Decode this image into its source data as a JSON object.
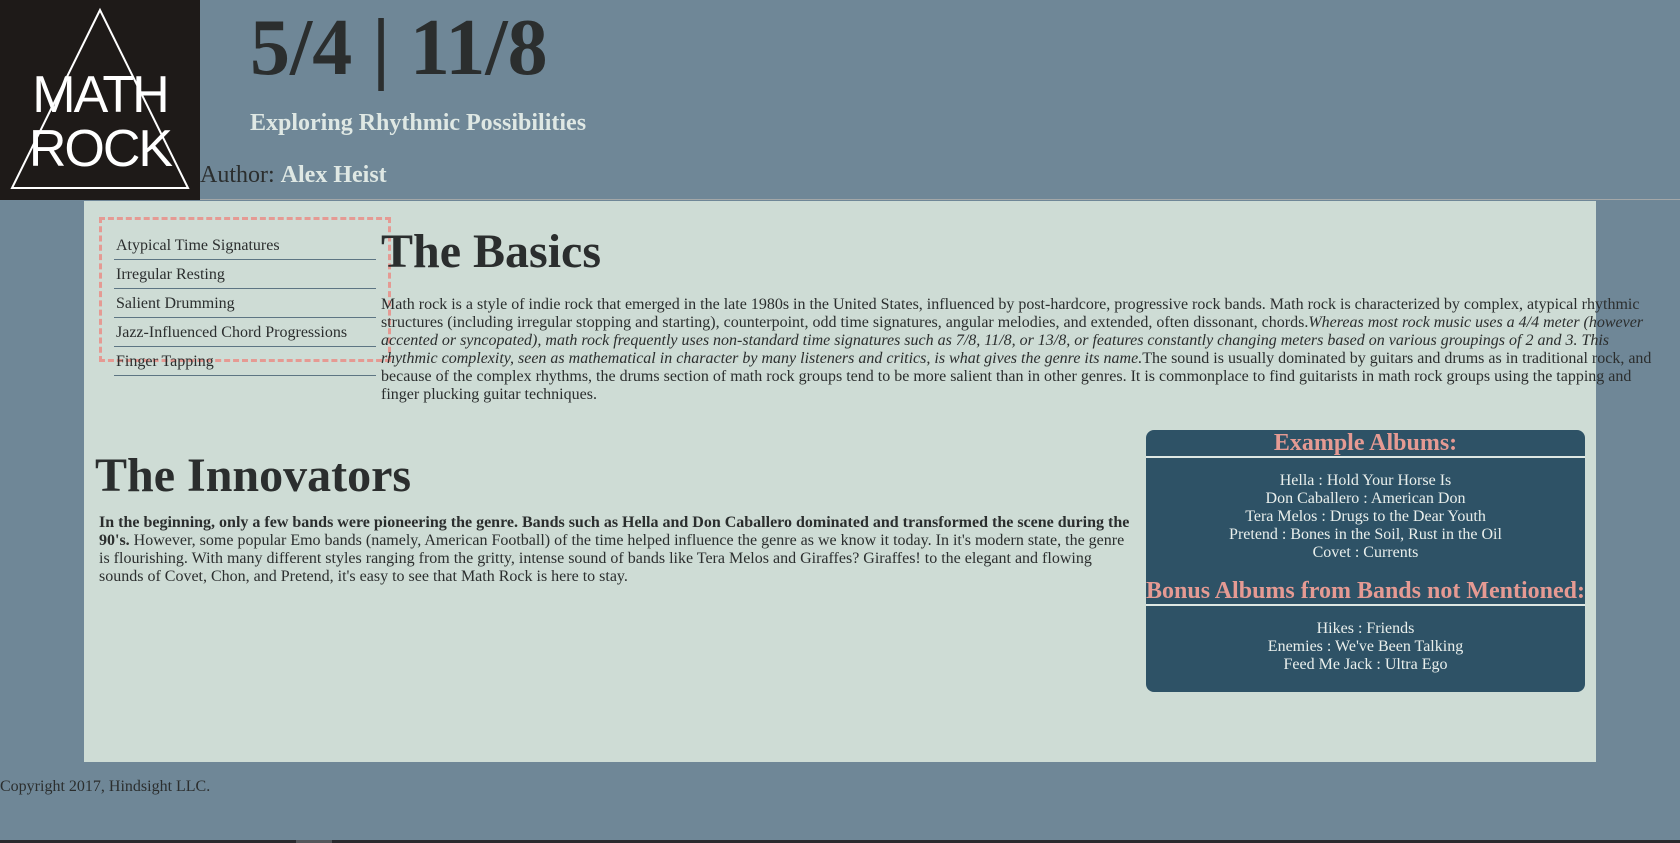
{
  "header": {
    "logo_text": "MATH ROCK",
    "title": "5/4 | 11/8",
    "subtitle": "Exploring Rhythmic Possibilities",
    "author_label": "Author:",
    "author_name": "Alex Heist"
  },
  "sidebar": {
    "items": [
      {
        "label": "Atypical Time Signatures"
      },
      {
        "label": "Irregular Resting"
      },
      {
        "label": "Salient Drumming"
      },
      {
        "label": "Jazz-Influenced Chord Progressions"
      },
      {
        "label": "Finger Tapping"
      }
    ]
  },
  "basics": {
    "title": "The Basics",
    "text_1": "Math rock is a style of indie rock that emerged in the late 1980s in the United States, influenced by post-hardcore, progressive rock bands. Math rock is characterized by complex, atypical rhythmic structures (including irregular stopping and starting), counterpoint, odd time signatures, angular melodies, and extended, often dissonant, chords.",
    "text_italic": "Whereas most rock music uses a 4/4 meter (however accented or syncopated), math rock frequently uses non-standard time signatures such as 7/8, 11/8, or 13/8, or features constantly changing meters based on various groupings of 2 and 3. This rhythmic complexity, seen as mathematical in character by many listeners and critics, is what gives the genre its name.",
    "text_2": "The sound is usually dominated by guitars and drums as in traditional rock, and because of the complex rhythms, the drums section of math rock groups tend to be more salient than in other genres. It is commonplace to find guitarists in math rock groups using the tapping and finger plucking guitar techniques."
  },
  "innovators": {
    "title": "The Innovators",
    "text_bold": "In the beginning, only a few bands were pioneering the genre. Bands such as Hella and Don Caballero dominated and transformed the scene during the 90's.",
    "text_rest": " However, some popular Emo bands (namely, American Football) of the time helped influence the genre as we know it today. In it's modern state, the genre is flourishing. With many different styles ranging from the gritty, intense sound of bands like Tera Melos and Giraffes? Giraffes! to the elegant and flowing sounds of Covet, Chon, and Pretend, it's easy to see that Math Rock is here to stay."
  },
  "albums": {
    "example_title": "Example Albums:",
    "example_items": [
      "Hella : Hold Your Horse Is",
      "Don Caballero : American Don",
      "Tera Melos : Drugs to the Dear Youth",
      "Pretend : Bones in the Soil, Rust in the Oil",
      "Covet : Currents"
    ],
    "bonus_title": "Bonus Albums from Bands not Mentioned:",
    "bonus_items": [
      "Hikes : Friends",
      "Enemies : We've Been Talking",
      "Feed Me Jack : Ultra Ego"
    ]
  },
  "footer": {
    "copyright": "Copyright 2017, Hindsight LLC."
  },
  "colors": {
    "page_bg": "#6f8797",
    "content_bg": "#cedcd5",
    "accent_pink": "#e59a93",
    "albums_bg": "#2e5266",
    "logo_bg": "#1e1a18"
  }
}
